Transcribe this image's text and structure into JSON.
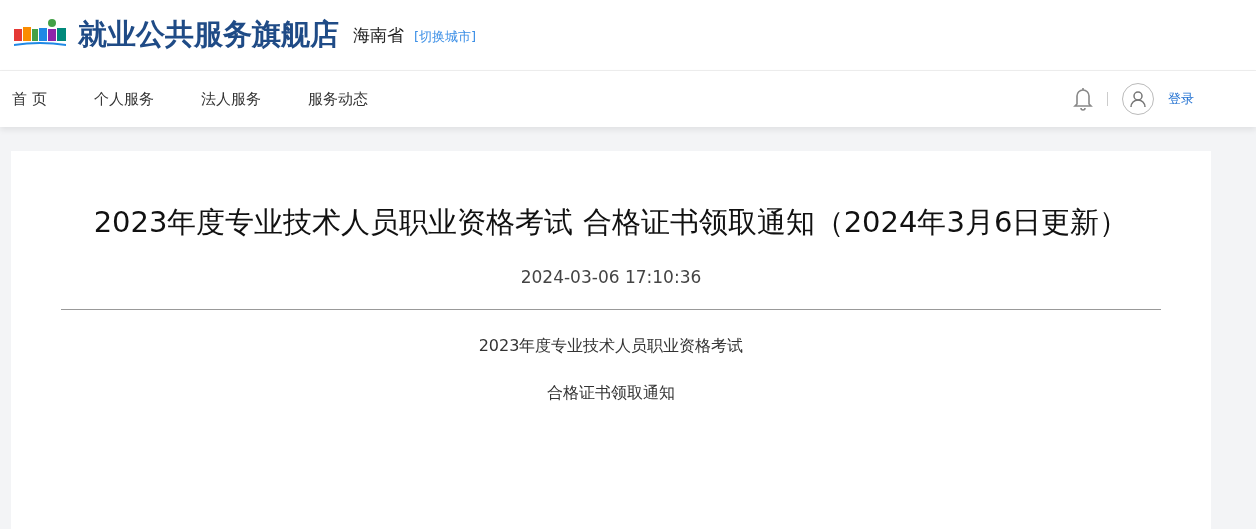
{
  "header": {
    "site_title": "就业公共服务旗舰店",
    "province": "海南省",
    "switch_city": "[切换城市]"
  },
  "nav": {
    "items": [
      {
        "label": "首 页",
        "selected": false
      },
      {
        "label": "个人服务",
        "selected": false
      },
      {
        "label": "法人服务",
        "selected": false
      },
      {
        "label": "服务动态",
        "selected": false
      }
    ],
    "login": "登录"
  },
  "article": {
    "title": "2023年度专业技术人员职业资格考试 合格证书领取通知（2024年3月6日更新）",
    "date": "2024-03-06 17:10:36",
    "paragraphs": [
      "2023年度专业技术人员职业资格考试",
      "合格证书领取通知"
    ]
  }
}
